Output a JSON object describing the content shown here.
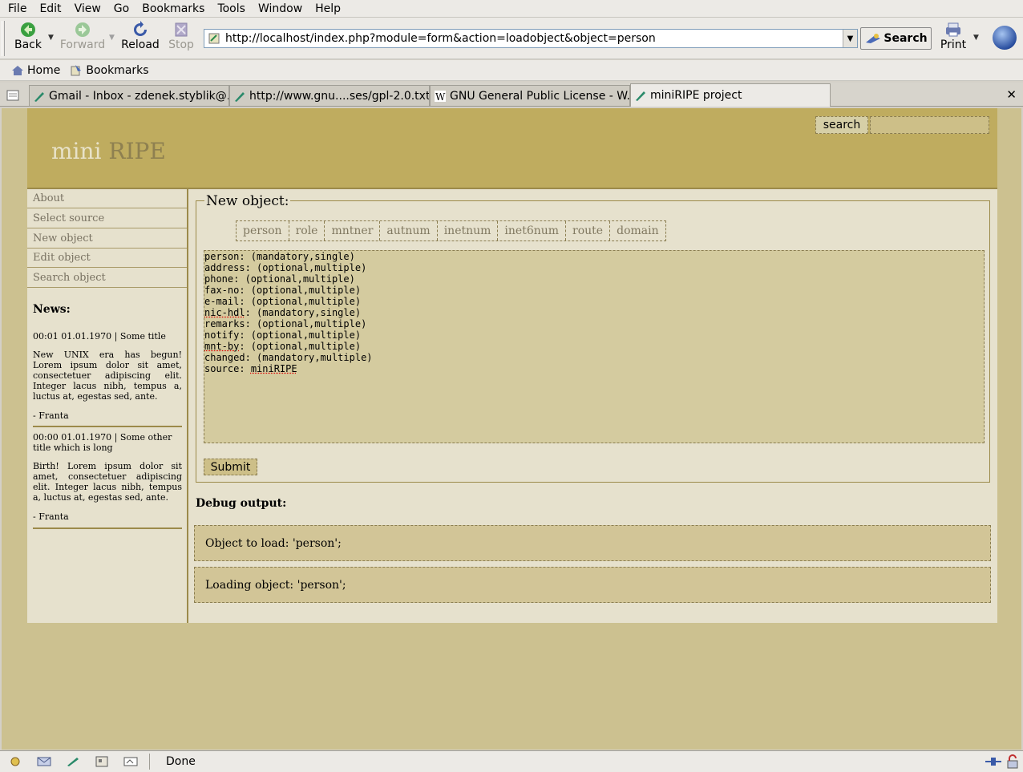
{
  "menu": [
    "File",
    "Edit",
    "View",
    "Go",
    "Bookmarks",
    "Tools",
    "Window",
    "Help"
  ],
  "nav": {
    "back": "Back",
    "forward": "Forward",
    "reload": "Reload",
    "stop": "Stop",
    "url": "http://localhost/index.php?module=form&action=loadobject&object=person",
    "search": "Search",
    "print": "Print"
  },
  "personal_toolbar": {
    "home": "Home",
    "bookmarks": "Bookmarks"
  },
  "tabs": [
    {
      "label": "Gmail - Inbox - zdenek.styblik@..."
    },
    {
      "label": "http://www.gnu....ses/gpl-2.0.txt"
    },
    {
      "label": "GNU General Public License - W..."
    },
    {
      "label": "miniRIPE project"
    }
  ],
  "page": {
    "logo_mini": "mini",
    "logo_ripe": "RIPE",
    "search_button": "search",
    "search_input": "",
    "sidebar": [
      {
        "label": "About"
      },
      {
        "label": "Select source"
      },
      {
        "label": "New object"
      },
      {
        "label": "Edit object"
      },
      {
        "label": "Search object"
      }
    ],
    "news_title": "News:",
    "news": [
      {
        "header": "00:01 01.01.1970 | Some title",
        "body": "New UNIX era has begun! Lorem ipsum dolor sit amet, consectetuer adipiscing elit. Integer lacus nibh, tempus a, luctus at, egestas sed, ante.",
        "author": "- Franta"
      },
      {
        "header": "00:00 01.01.1970 | Some other title which is long",
        "body": "Birth! Lorem ipsum dolor sit amet, consectetuer adipiscing elit. Integer lacus nibh, tempus a, luctus at, egestas sed, ante.",
        "author": "- Franta"
      }
    ],
    "form_legend": "New object:",
    "object_tabs": [
      "person",
      "role",
      "mntner",
      "autnum",
      "inetnum",
      "inet6num",
      "route",
      "domain"
    ],
    "textarea_lines": [
      {
        "key": "person",
        "rest": ": (mandatory,single)",
        "spell": false
      },
      {
        "key": "address",
        "rest": ": (optional,multiple)",
        "spell": false
      },
      {
        "key": "phone",
        "rest": ": (optional,multiple)",
        "spell": false
      },
      {
        "key": "fax-no",
        "rest": ": (optional,multiple)",
        "spell": false
      },
      {
        "key": "e-mail",
        "rest": ": (optional,multiple)",
        "spell": false
      },
      {
        "key": "nic-hdl",
        "rest": ": (mandatory,single)",
        "spell": true
      },
      {
        "key": "remarks",
        "rest": ": (optional,multiple)",
        "spell": false
      },
      {
        "key": "notify",
        "rest": ": (optional,multiple)",
        "spell": false
      },
      {
        "key": "mnt-by",
        "rest": ": (optional,multiple)",
        "spell": true
      },
      {
        "key": "changed",
        "rest": ": (mandatory,multiple)",
        "spell": false
      },
      {
        "key": "source",
        "rest": ": miniRIPE",
        "spell": false
      }
    ],
    "submit": "Submit",
    "debug_title": "Debug output:",
    "debug_lines": [
      "Object to load: 'person';",
      "Loading object: 'person';"
    ]
  },
  "status": "Done"
}
